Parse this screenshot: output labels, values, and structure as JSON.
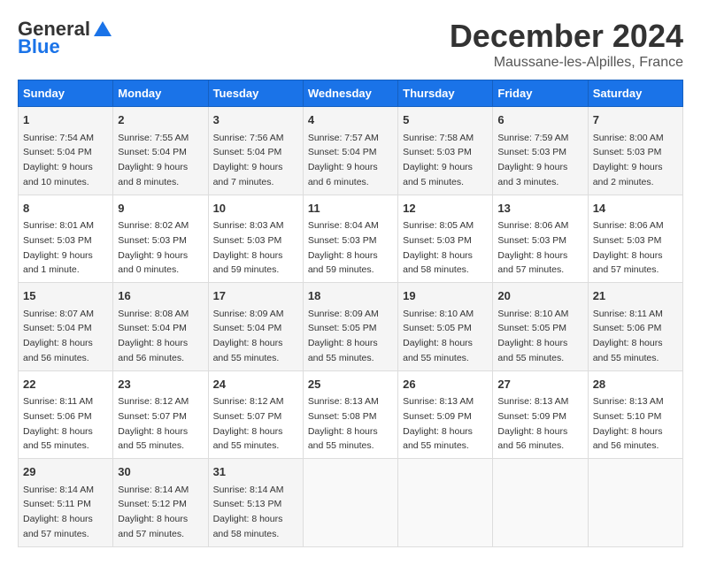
{
  "header": {
    "logo_general": "General",
    "logo_blue": "Blue",
    "month": "December 2024",
    "location": "Maussane-les-Alpilles, France"
  },
  "days_of_week": [
    "Sunday",
    "Monday",
    "Tuesday",
    "Wednesday",
    "Thursday",
    "Friday",
    "Saturday"
  ],
  "weeks": [
    [
      {
        "day": "1",
        "sunrise": "Sunrise: 7:54 AM",
        "sunset": "Sunset: 5:04 PM",
        "daylight": "Daylight: 9 hours and 10 minutes."
      },
      {
        "day": "2",
        "sunrise": "Sunrise: 7:55 AM",
        "sunset": "Sunset: 5:04 PM",
        "daylight": "Daylight: 9 hours and 8 minutes."
      },
      {
        "day": "3",
        "sunrise": "Sunrise: 7:56 AM",
        "sunset": "Sunset: 5:04 PM",
        "daylight": "Daylight: 9 hours and 7 minutes."
      },
      {
        "day": "4",
        "sunrise": "Sunrise: 7:57 AM",
        "sunset": "Sunset: 5:04 PM",
        "daylight": "Daylight: 9 hours and 6 minutes."
      },
      {
        "day": "5",
        "sunrise": "Sunrise: 7:58 AM",
        "sunset": "Sunset: 5:03 PM",
        "daylight": "Daylight: 9 hours and 5 minutes."
      },
      {
        "day": "6",
        "sunrise": "Sunrise: 7:59 AM",
        "sunset": "Sunset: 5:03 PM",
        "daylight": "Daylight: 9 hours and 3 minutes."
      },
      {
        "day": "7",
        "sunrise": "Sunrise: 8:00 AM",
        "sunset": "Sunset: 5:03 PM",
        "daylight": "Daylight: 9 hours and 2 minutes."
      }
    ],
    [
      {
        "day": "8",
        "sunrise": "Sunrise: 8:01 AM",
        "sunset": "Sunset: 5:03 PM",
        "daylight": "Daylight: 9 hours and 1 minute."
      },
      {
        "day": "9",
        "sunrise": "Sunrise: 8:02 AM",
        "sunset": "Sunset: 5:03 PM",
        "daylight": "Daylight: 9 hours and 0 minutes."
      },
      {
        "day": "10",
        "sunrise": "Sunrise: 8:03 AM",
        "sunset": "Sunset: 5:03 PM",
        "daylight": "Daylight: 8 hours and 59 minutes."
      },
      {
        "day": "11",
        "sunrise": "Sunrise: 8:04 AM",
        "sunset": "Sunset: 5:03 PM",
        "daylight": "Daylight: 8 hours and 59 minutes."
      },
      {
        "day": "12",
        "sunrise": "Sunrise: 8:05 AM",
        "sunset": "Sunset: 5:03 PM",
        "daylight": "Daylight: 8 hours and 58 minutes."
      },
      {
        "day": "13",
        "sunrise": "Sunrise: 8:06 AM",
        "sunset": "Sunset: 5:03 PM",
        "daylight": "Daylight: 8 hours and 57 minutes."
      },
      {
        "day": "14",
        "sunrise": "Sunrise: 8:06 AM",
        "sunset": "Sunset: 5:03 PM",
        "daylight": "Daylight: 8 hours and 57 minutes."
      }
    ],
    [
      {
        "day": "15",
        "sunrise": "Sunrise: 8:07 AM",
        "sunset": "Sunset: 5:04 PM",
        "daylight": "Daylight: 8 hours and 56 minutes."
      },
      {
        "day": "16",
        "sunrise": "Sunrise: 8:08 AM",
        "sunset": "Sunset: 5:04 PM",
        "daylight": "Daylight: 8 hours and 56 minutes."
      },
      {
        "day": "17",
        "sunrise": "Sunrise: 8:09 AM",
        "sunset": "Sunset: 5:04 PM",
        "daylight": "Daylight: 8 hours and 55 minutes."
      },
      {
        "day": "18",
        "sunrise": "Sunrise: 8:09 AM",
        "sunset": "Sunset: 5:05 PM",
        "daylight": "Daylight: 8 hours and 55 minutes."
      },
      {
        "day": "19",
        "sunrise": "Sunrise: 8:10 AM",
        "sunset": "Sunset: 5:05 PM",
        "daylight": "Daylight: 8 hours and 55 minutes."
      },
      {
        "day": "20",
        "sunrise": "Sunrise: 8:10 AM",
        "sunset": "Sunset: 5:05 PM",
        "daylight": "Daylight: 8 hours and 55 minutes."
      },
      {
        "day": "21",
        "sunrise": "Sunrise: 8:11 AM",
        "sunset": "Sunset: 5:06 PM",
        "daylight": "Daylight: 8 hours and 55 minutes."
      }
    ],
    [
      {
        "day": "22",
        "sunrise": "Sunrise: 8:11 AM",
        "sunset": "Sunset: 5:06 PM",
        "daylight": "Daylight: 8 hours and 55 minutes."
      },
      {
        "day": "23",
        "sunrise": "Sunrise: 8:12 AM",
        "sunset": "Sunset: 5:07 PM",
        "daylight": "Daylight: 8 hours and 55 minutes."
      },
      {
        "day": "24",
        "sunrise": "Sunrise: 8:12 AM",
        "sunset": "Sunset: 5:07 PM",
        "daylight": "Daylight: 8 hours and 55 minutes."
      },
      {
        "day": "25",
        "sunrise": "Sunrise: 8:13 AM",
        "sunset": "Sunset: 5:08 PM",
        "daylight": "Daylight: 8 hours and 55 minutes."
      },
      {
        "day": "26",
        "sunrise": "Sunrise: 8:13 AM",
        "sunset": "Sunset: 5:09 PM",
        "daylight": "Daylight: 8 hours and 55 minutes."
      },
      {
        "day": "27",
        "sunrise": "Sunrise: 8:13 AM",
        "sunset": "Sunset: 5:09 PM",
        "daylight": "Daylight: 8 hours and 56 minutes."
      },
      {
        "day": "28",
        "sunrise": "Sunrise: 8:13 AM",
        "sunset": "Sunset: 5:10 PM",
        "daylight": "Daylight: 8 hours and 56 minutes."
      }
    ],
    [
      {
        "day": "29",
        "sunrise": "Sunrise: 8:14 AM",
        "sunset": "Sunset: 5:11 PM",
        "daylight": "Daylight: 8 hours and 57 minutes."
      },
      {
        "day": "30",
        "sunrise": "Sunrise: 8:14 AM",
        "sunset": "Sunset: 5:12 PM",
        "daylight": "Daylight: 8 hours and 57 minutes."
      },
      {
        "day": "31",
        "sunrise": "Sunrise: 8:14 AM",
        "sunset": "Sunset: 5:13 PM",
        "daylight": "Daylight: 8 hours and 58 minutes."
      },
      null,
      null,
      null,
      null
    ]
  ]
}
